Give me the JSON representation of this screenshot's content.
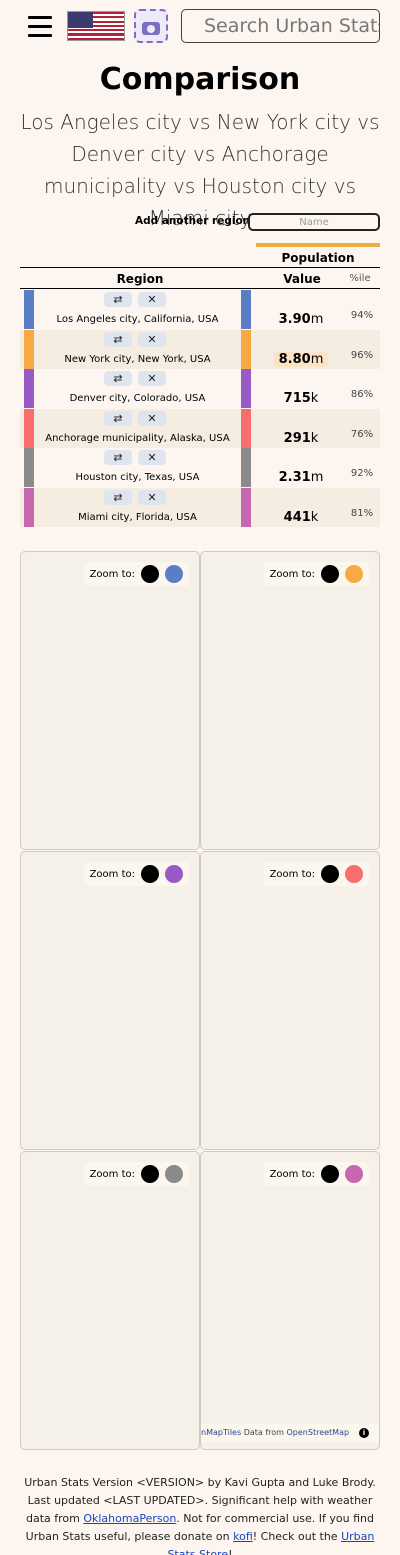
{
  "header": {
    "search_placeholder": "Search Urban Stats"
  },
  "title": "Comparison",
  "subtitle": "Los Angeles city vs New York city vs Denver city vs Anchorage municipality vs Houston city vs Miami city",
  "add_region": {
    "label": "Add another region:",
    "placeholder": "Name"
  },
  "table": {
    "stat_header": "Population",
    "columns": {
      "region": "Region",
      "value": "Value",
      "percentile": "%ile"
    },
    "rows": [
      {
        "name": "Los Angeles city, California, USA",
        "value": "3.90",
        "unit": "m",
        "percentile": "94%",
        "color": "#5a7dc8"
      },
      {
        "name": "New York city, New York, USA",
        "value": "8.80",
        "unit": "m",
        "percentile": "96%",
        "color": "#f7aa41"
      },
      {
        "name": "Denver city, Colorado, USA",
        "value": "715",
        "unit": "k",
        "percentile": "86%",
        "color": "#975ac6"
      },
      {
        "name": "Anchorage municipality, Alaska, USA",
        "value": "291",
        "unit": "k",
        "percentile": "76%",
        "color": "#f96d6d"
      },
      {
        "name": "Houston city, Texas, USA",
        "value": "2.31",
        "unit": "m",
        "percentile": "92%",
        "color": "#8a8a8a"
      },
      {
        "name": "Miami city, Florida, USA",
        "value": "441",
        "unit": "k",
        "percentile": "81%",
        "color": "#c767b0"
      }
    ],
    "row_icons": {
      "swap": "search-swap-icon",
      "remove": "close-icon"
    }
  },
  "maps": {
    "zoom_label": "Zoom to:",
    "all_dot_color": "#000000",
    "attribution": {
      "tiles": "nMapTiles",
      "data_from": "Data from",
      "osm": "OpenStreetMap"
    }
  },
  "footer": {
    "t1": "Urban Stats Version <VERSION> by Kavi Gupta and Luke Brody. Last updated <LAST UPDATED>. Significant help with weather data from ",
    "link1": "OklahomaPerson",
    "t2": ". Not for commercial use. If you find Urban Stats useful, please donate on ",
    "link2": "kofi",
    "t3": "! Check out the ",
    "link3": "Urban Stats Store",
    "t4": "!"
  }
}
